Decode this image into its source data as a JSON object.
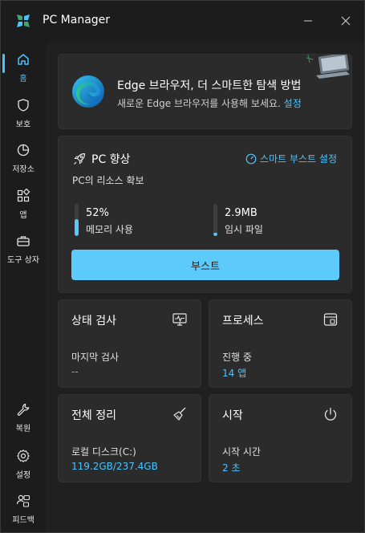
{
  "window": {
    "title": "PC Manager"
  },
  "sidebar": {
    "items": [
      {
        "label": "홈",
        "icon": "home-icon",
        "active": true
      },
      {
        "label": "보호",
        "icon": "shield-icon"
      },
      {
        "label": "저장소",
        "icon": "storage-pie-icon"
      },
      {
        "label": "앱",
        "icon": "apps-grid-icon"
      },
      {
        "label": "도구 상자",
        "icon": "toolbox-icon"
      }
    ],
    "bottom_items": [
      {
        "label": "복원",
        "icon": "wrench-icon"
      },
      {
        "label": "설정",
        "icon": "gear-icon"
      },
      {
        "label": "피드백",
        "icon": "feedback-icon"
      }
    ]
  },
  "banner": {
    "title": "Edge 브라우저, 더 스마트한 탐색 방법",
    "subtitle": "새로운 Edge 브라우저를 사용해 보세요.",
    "link": "설정"
  },
  "boost": {
    "title": "PC 향상",
    "settings_link": "스마트 부스트 설정",
    "subtitle": "PC의 리소스 확보",
    "memory": {
      "value": "52%",
      "label": "메모리 사용",
      "fill_fraction": 0.52
    },
    "temp": {
      "value": "2.9MB",
      "label": "임시 파일",
      "fill_fraction": 0.05
    },
    "button_label": "부스트"
  },
  "tiles": {
    "health": {
      "title": "상태 검사",
      "label": "마지막 검사",
      "value": "--"
    },
    "process": {
      "title": "프로세스",
      "label": "진행 중",
      "value": "14 앱"
    },
    "cleanup": {
      "title": "전체 정리",
      "label": "로컬 디스크(C:)",
      "value": "119.2GB/237.4GB"
    },
    "startup": {
      "title": "시작",
      "label": "시작 시간",
      "value": "2 초"
    }
  },
  "colors": {
    "accent": "#4cc2ff",
    "boost_button": "#5ccbfb",
    "background": "#1c1c1c",
    "card": "#2b2b2b"
  }
}
